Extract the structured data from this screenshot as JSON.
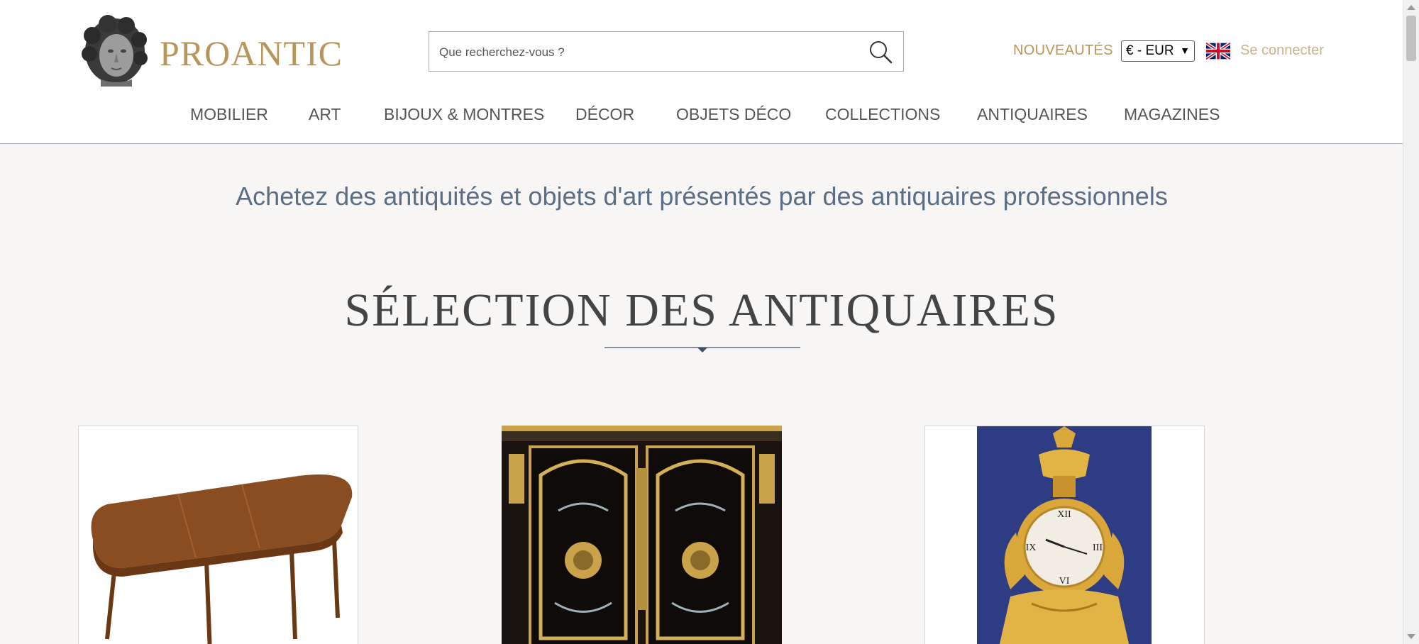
{
  "header": {
    "brand": "PROANTIC",
    "search_placeholder": "Que recherchez-vous ?",
    "new_label": "NOUVEAUTÉS",
    "currency": "€ - EUR",
    "language_flag": "uk-flag-icon",
    "login_label": "Se connecter"
  },
  "nav": {
    "items": [
      {
        "label": "MOBILIER"
      },
      {
        "label": "ART"
      },
      {
        "label": "BIJOUX & MONTRES"
      },
      {
        "label": "DÉCOR"
      },
      {
        "label": "OBJETS DÉCO"
      },
      {
        "label": "COLLECTIONS"
      },
      {
        "label": "ANTIQUAIRES"
      },
      {
        "label": "MAGAZINES"
      }
    ]
  },
  "main": {
    "tagline": "Achetez des antiquités et objets d'art présentés par des antiquaires professionnels",
    "section_title": "SÉLECTION DES ANTIQUAIRES",
    "cards": [
      {
        "image": "oval-wooden-table-image"
      },
      {
        "image": "boulle-cabinet-image"
      },
      {
        "image": "gilt-bronze-clock-image"
      }
    ]
  },
  "colors": {
    "brand_gold": "#b8965b",
    "login_gold": "#cbb48a",
    "tagline_blue": "#5a6f86",
    "page_bg": "#f7f6f4"
  }
}
